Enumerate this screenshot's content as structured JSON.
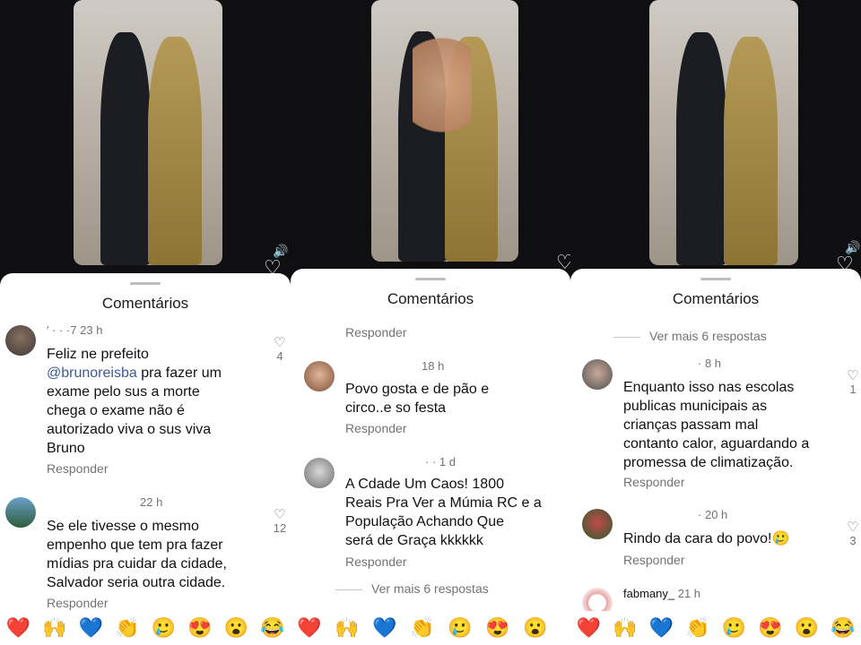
{
  "sheet_title": "Comentários",
  "reply_label": "Responder",
  "emojis": [
    "❤️",
    "🙌",
    "💙",
    "👏",
    "🥲",
    "😍",
    "😮",
    "😂"
  ],
  "panel1": {
    "comments": [
      {
        "user": "′ · ·  ·7",
        "time": "23 h",
        "text_prefix": "Feliz ne prefeito",
        "mention": "@brunoreisba",
        "text_suffix": " pra fazer um\nexame pelo sus a morte\nchega o exame não é\nautorizado viva o sus viva\nBruno",
        "likes": "4"
      },
      {
        "user": "",
        "time": "22 h",
        "text": "Se ele tivesse o mesmo\nempenho que tem pra fazer\nmídias pra cuidar da cidade,\nSalvador seria outra cidade.",
        "likes": "12"
      }
    ]
  },
  "panel2": {
    "top_reply": "Responder",
    "comments": [
      {
        "user": "",
        "time": "18 h",
        "text": "Povo gosta e de pão e\ncirco..e so festa"
      },
      {
        "user": "· ·",
        "time": "1 d",
        "text": "A Cdade Um Caos! 1800\nReais Pra Ver a Múmia RC e a\nPopulação Achando Que\nserá de Graça kkkkkk"
      }
    ],
    "more_replies": "Ver mais 6 respostas"
  },
  "panel3": {
    "more_replies": "Ver mais 6 respostas",
    "comments": [
      {
        "user": "·",
        "time": "8 h",
        "text": "Enquanto isso nas escolas\npublicas municipais as\ncrianças passam mal\ncontanto calor, aguardando a\npromessa de climatização.",
        "likes": "1"
      },
      {
        "user": "·",
        "time": "20 h",
        "text": "Rindo da cara do povo!🥲",
        "likes": "3"
      },
      {
        "user": "fabmany_",
        "time": "21 h"
      }
    ]
  }
}
